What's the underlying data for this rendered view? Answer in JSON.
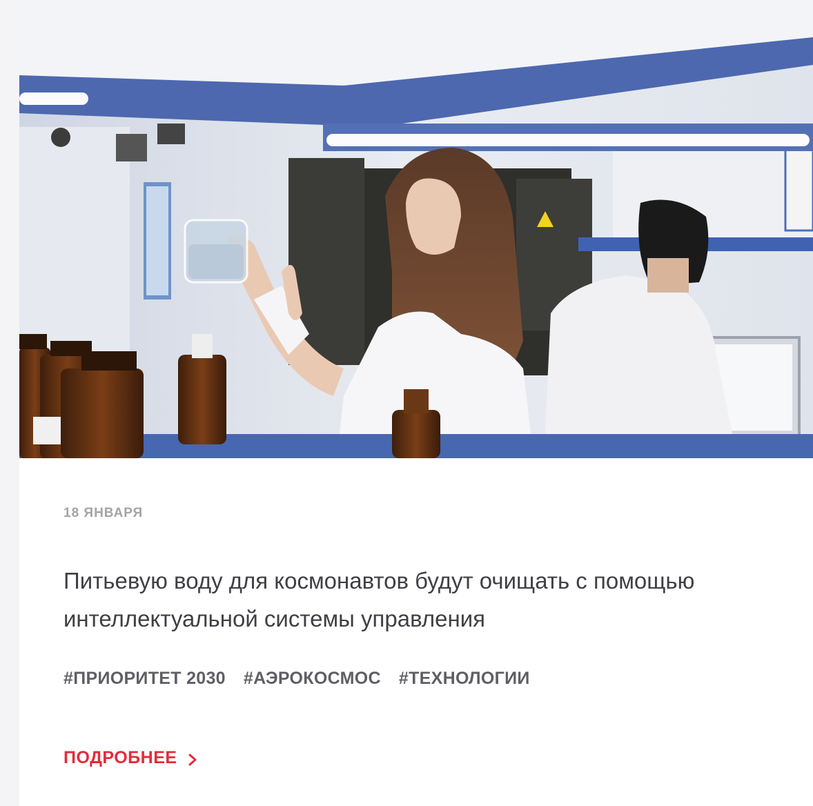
{
  "card": {
    "image_alt": "",
    "date": "18 ЯНВАРЯ",
    "title": "Питьевую воду для космонавтов будут очищать с помощью интеллектуальной системы управления",
    "tags": [
      "#ПРИОРИТЕТ 2030",
      "#АЭРОКОСМОС",
      "#ТЕХНОЛОГИИ"
    ],
    "more_label": "ПОДРОБНЕЕ",
    "more_icon": "chevron-right-icon"
  },
  "colors": {
    "accent": "#e42b3a",
    "date": "#a3a3a8",
    "title": "#3f3f45",
    "tag": "#5e5e64"
  }
}
